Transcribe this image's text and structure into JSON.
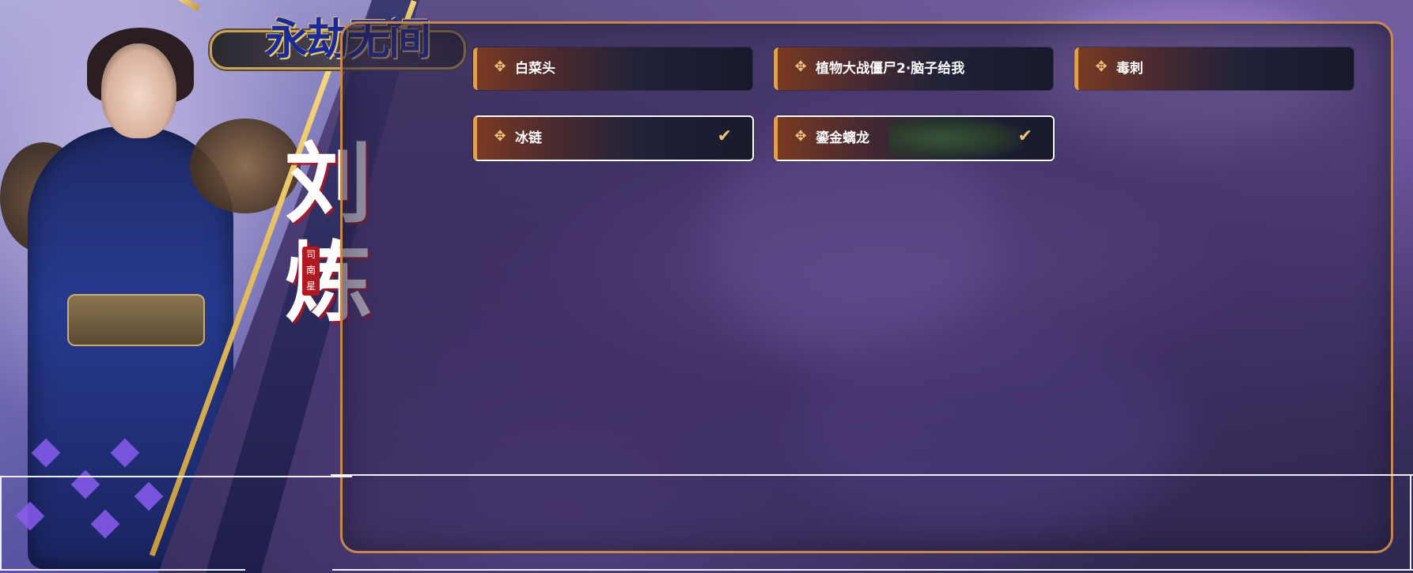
{
  "logo": {
    "text": "永劫无间"
  },
  "hero": {
    "name": "刘炼",
    "seal": "司南星"
  },
  "cards": [
    {
      "label": "白菜头",
      "selected": false
    },
    {
      "label": "植物大战僵尸2·脑子给我",
      "selected": false
    },
    {
      "label": "毒刺",
      "selected": false
    },
    {
      "label": "冰链",
      "selected": true
    },
    {
      "label": "鎏金螭龙",
      "selected": true
    }
  ],
  "icons": {
    "card": "shuriken-icon",
    "check": "check-icon"
  },
  "colors": {
    "accent": "#e0a052",
    "panel_border": "#c6884b",
    "diamond": "#8a5cf0"
  }
}
